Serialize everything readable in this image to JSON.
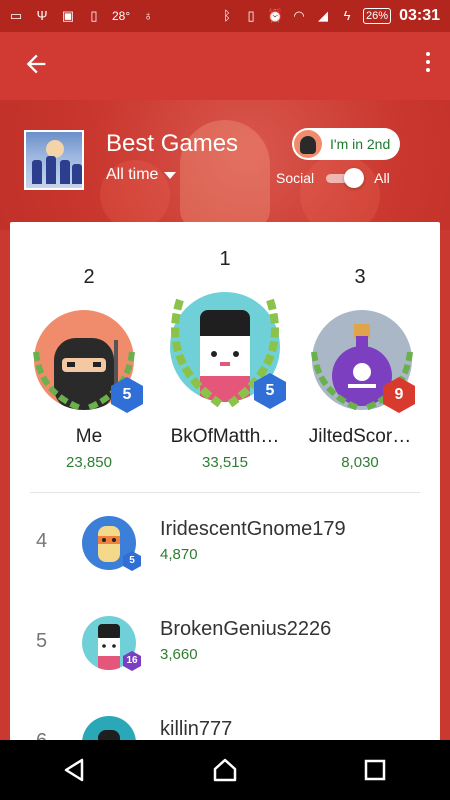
{
  "status_bar": {
    "temperature": "28°",
    "battery": "26%",
    "time": "03:31",
    "icons": [
      "message-icon",
      "usb-icon",
      "image-icon",
      "battery-saver-icon",
      "lightbulb-icon",
      "bluetooth-icon",
      "vibrate-icon",
      "alarm-icon",
      "wifi-icon",
      "signal-icon",
      "charging-icon"
    ]
  },
  "appbar": {
    "back_icon": "arrow-back-icon",
    "more_icon": "more-vert-icon"
  },
  "header": {
    "title": "Best Games",
    "timeframe": "All time",
    "rank_chip": "I'm in 2nd",
    "toggle_left": "Social",
    "toggle_right": "All",
    "toggle_state": "All"
  },
  "podium": [
    {
      "rank": "2",
      "name": "Me",
      "score": "23,850",
      "level": "5",
      "badge_color": "#2f6fd6",
      "avatar_bg": "#f08c6c"
    },
    {
      "rank": "1",
      "name": "BkOfMatth…",
      "score": "33,515",
      "level": "5",
      "badge_color": "#2f6fd6",
      "avatar_bg": "#6fd0d8"
    },
    {
      "rank": "3",
      "name": "JiltedScor…",
      "score": "8,030",
      "level": "9",
      "badge_color": "#d83a2e",
      "avatar_bg": "#aab7c7"
    }
  ],
  "list": [
    {
      "rank": "4",
      "name": "IridescentGnome179",
      "score": "4,870",
      "level": "5",
      "level_color": "#2f6fd6",
      "avatar_bg": "#3b7fd9"
    },
    {
      "rank": "5",
      "name": "BrokenGenius2226",
      "score": "3,660",
      "level": "16",
      "level_color": "#7a3fc2",
      "avatar_bg": "#6fd0d8"
    },
    {
      "rank": "6",
      "name": "killin777",
      "score": "",
      "level": "",
      "level_color": "#2f6fd6",
      "avatar_bg": "#2aa8b8"
    }
  ],
  "colors": {
    "primary": "#d13a32",
    "score_green": "#2e7d32"
  }
}
